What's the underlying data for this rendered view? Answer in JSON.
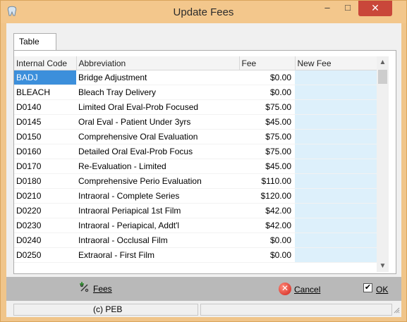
{
  "window": {
    "title": "Update Fees",
    "controls": {
      "minimize": "–",
      "maximize": "□",
      "close": "✕"
    }
  },
  "tabs": [
    {
      "label": "Table",
      "active": true
    }
  ],
  "grid": {
    "columns": [
      "Internal Code",
      "Abbreviation",
      "Fee",
      "New Fee"
    ],
    "rows": [
      {
        "code": "BADJ",
        "abbreviation": "Bridge Adjustment",
        "fee": "$0.00",
        "new_fee": ""
      },
      {
        "code": "BLEACH",
        "abbreviation": "Bleach Tray Delivery",
        "fee": "$0.00",
        "new_fee": ""
      },
      {
        "code": "D0140",
        "abbreviation": "Limited Oral Eval-Prob Focused",
        "fee": "$75.00",
        "new_fee": ""
      },
      {
        "code": "D0145",
        "abbreviation": "Oral Eval - Patient Under 3yrs",
        "fee": "$45.00",
        "new_fee": ""
      },
      {
        "code": "D0150",
        "abbreviation": "Comprehensive Oral Evaluation",
        "fee": "$75.00",
        "new_fee": ""
      },
      {
        "code": "D0160",
        "abbreviation": "Detailed Oral Eval-Prob Focus",
        "fee": "$75.00",
        "new_fee": ""
      },
      {
        "code": "D0170",
        "abbreviation": "Re-Evaluation - Limited",
        "fee": "$45.00",
        "new_fee": ""
      },
      {
        "code": "D0180",
        "abbreviation": "Comprehensive Perio Evaluation",
        "fee": "$110.00",
        "new_fee": ""
      },
      {
        "code": "D0210",
        "abbreviation": "Intraoral - Complete Series",
        "fee": "$120.00",
        "new_fee": ""
      },
      {
        "code": "D0220",
        "abbreviation": "Intraoral Periapical 1st Film",
        "fee": "$42.00",
        "new_fee": ""
      },
      {
        "code": "D0230",
        "abbreviation": "Intraoral - Periapical, Addt'l",
        "fee": "$42.00",
        "new_fee": ""
      },
      {
        "code": "D0240",
        "abbreviation": "Intraoral - Occlusal Film",
        "fee": "$0.00",
        "new_fee": ""
      },
      {
        "code": "D0250",
        "abbreviation": "Extraoral - First Film",
        "fee": "$0.00",
        "new_fee": ""
      }
    ],
    "selected_row": 0
  },
  "toolbar": {
    "fees_label": "Fees",
    "cancel_label": "Cancel",
    "ok_label": "OK",
    "ok_checked": true
  },
  "status": {
    "text": "(c) PEB"
  },
  "icons": {
    "app": "tooth-icon",
    "fees": "percent-add-icon",
    "cancel": "cancel-icon",
    "ok": "checkbox-icon"
  },
  "colors": {
    "titlebar": "#f3c78c",
    "close_button": "#c9473a",
    "selection": "#3c8fdb",
    "new_fee_cell": "#ddf0fb",
    "toolbar": "#b9b9b9"
  }
}
